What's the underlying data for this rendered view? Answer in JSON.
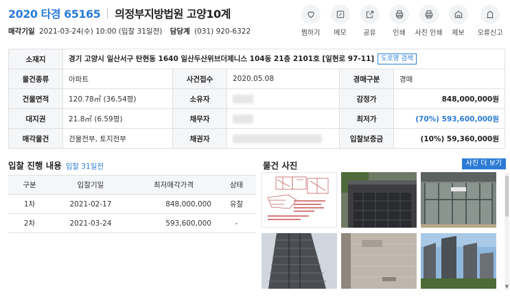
{
  "header": {
    "case_no": "2020 타경 65165",
    "court": "의정부지방법원 고양10계",
    "sale_label": "매각기일",
    "sale_value": "2021-03-24(수) 10:00 (입찰 31일전)",
    "contact_label": "담당계",
    "contact_value": "(031) 920-6322"
  },
  "actions": [
    {
      "label": "찜하기",
      "icon": "heart-icon"
    },
    {
      "label": "메모",
      "icon": "memo-icon"
    },
    {
      "label": "공유",
      "icon": "share-icon"
    },
    {
      "label": "인쇄",
      "icon": "print-icon"
    },
    {
      "label": "사진 인쇄",
      "icon": "photo-print-icon"
    },
    {
      "label": "제보",
      "icon": "report-icon"
    },
    {
      "label": "오류신고",
      "icon": "error-report-icon"
    }
  ],
  "info": {
    "address_label": "소재지",
    "address": "경기 고양시 일산서구 탄현동 1640 일산두산위브더제니스 104동 21층 2101호 [일현로 97-11]",
    "road_btn": "도로명 검색",
    "type_label": "물건종류",
    "type": "아파트",
    "received_label": "사건접수",
    "received": "2020.05.08",
    "auction_type_label": "경매구분",
    "auction_type": "경매",
    "building_area_label": "건물면적",
    "building_area": "120.78㎡ (36.54평)",
    "owner_label": "소유자",
    "appraisal_label": "감정가",
    "appraisal": "848,000,000원",
    "land_right_label": "대지권",
    "land_right": "21.8㎡ (6.59평)",
    "debtor_label": "채무자",
    "min_price_label": "최저가",
    "min_price": "(70%) 593,600,000원",
    "sale_object_label": "매각물건",
    "sale_object": "건물전부, 토지전부",
    "creditor_label": "채권자",
    "deposit_label": "입찰보증금",
    "deposit": "(10%) 59,360,000원"
  },
  "bid_section": {
    "title": "입찰 진행 내용",
    "note": "입찰 31일전",
    "headers": [
      "구분",
      "입찰기일",
      "최저매각가격",
      "상태"
    ],
    "rows": [
      [
        "1차",
        "2021-02-17",
        "848,000,000",
        "유찰"
      ],
      [
        "2차",
        "2021-03-24",
        "593,600,000",
        "-"
      ]
    ]
  },
  "photo_section": {
    "title": "물건 사진",
    "more_btn": "사진 더 보기"
  },
  "colors": {
    "accent": "#2b7bd6",
    "header_bg": "#f5f6f8",
    "border": "#e0e0e0"
  }
}
